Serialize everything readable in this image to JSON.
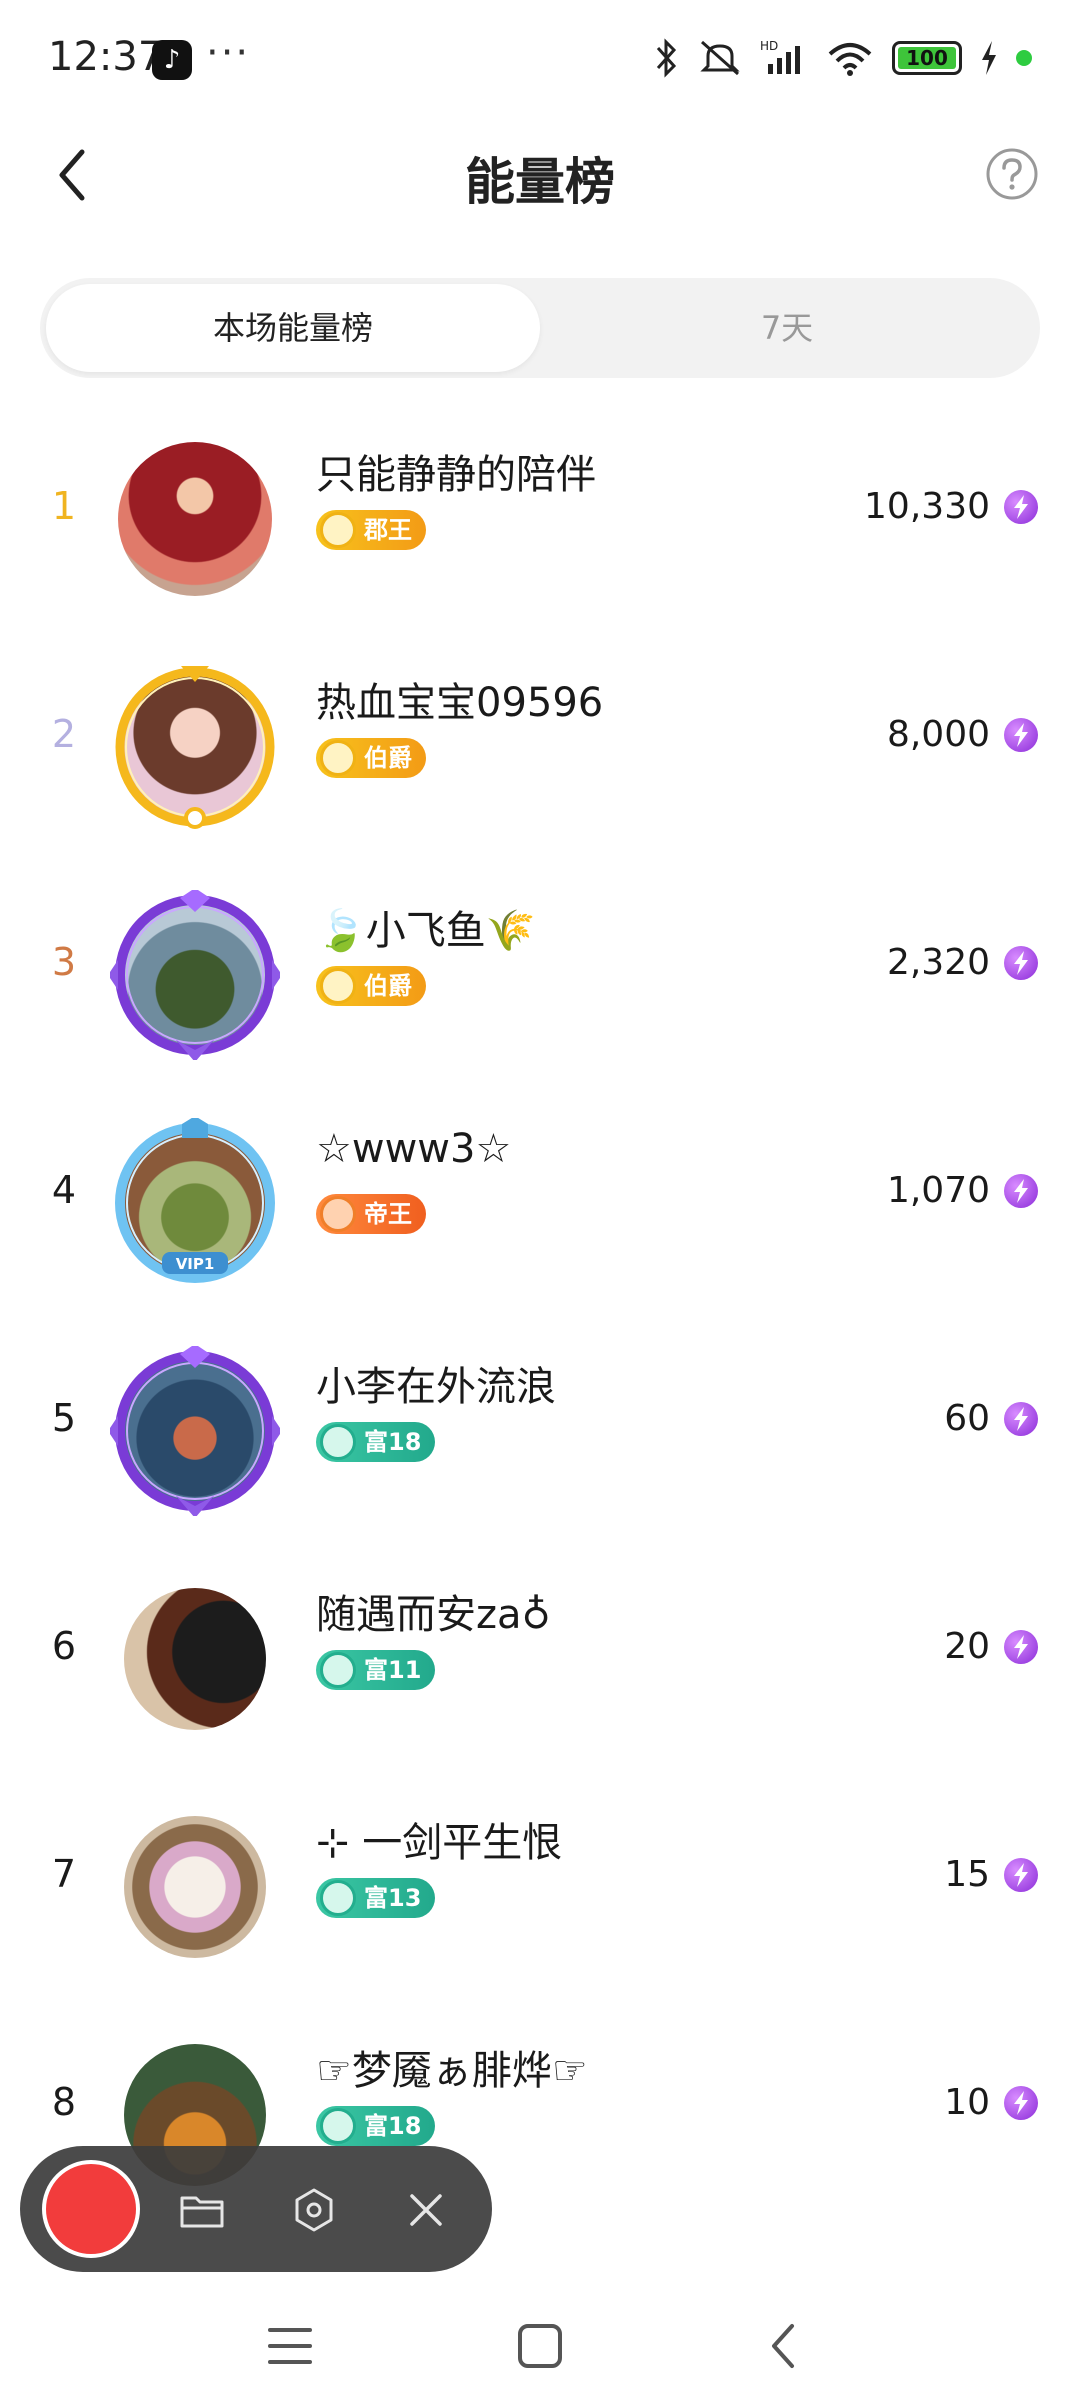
{
  "status": {
    "time": "12:37",
    "app_badge": "♪",
    "more": "···",
    "battery": "100",
    "network": "HD"
  },
  "header": {
    "title": "能量榜"
  },
  "tabs": [
    {
      "label": "本场能量榜",
      "active": true
    },
    {
      "label": "7天",
      "active": false
    }
  ],
  "colors": {
    "rank1": "#f0b420",
    "rank2": "#b4b0e0",
    "rank3": "#d07a45",
    "rank_default": "#1a1a1a",
    "energy": "#9b3be0"
  },
  "leaderboard": [
    {
      "rank": "1",
      "name": "只能静静的陪伴",
      "badge": "郡王",
      "badge_style": "gold",
      "score": "10,330"
    },
    {
      "rank": "2",
      "name": "热血宝宝09596",
      "badge": "伯爵",
      "badge_style": "gold",
      "score": "8,000"
    },
    {
      "rank": "3",
      "name": "🍃小飞鱼🌾",
      "badge": "伯爵",
      "badge_style": "gold",
      "score": "2,320"
    },
    {
      "rank": "4",
      "name": "☆www3☆",
      "badge": "帝王",
      "badge_style": "orange",
      "score": "1,070"
    },
    {
      "rank": "5",
      "name": "小李在外流浪",
      "badge": "富18",
      "badge_style": "teal",
      "score": "60"
    },
    {
      "rank": "6",
      "name": "随遇而安za♁",
      "badge": "富11",
      "badge_style": "teal",
      "score": "20"
    },
    {
      "rank": "7",
      "name": "⊹ 一剑平生恨",
      "badge": "富13",
      "badge_style": "teal",
      "score": "15"
    },
    {
      "rank": "8",
      "name": "☞梦魇ぁ腓烨☞",
      "badge": "富18",
      "badge_style": "teal",
      "score": "10"
    }
  ]
}
